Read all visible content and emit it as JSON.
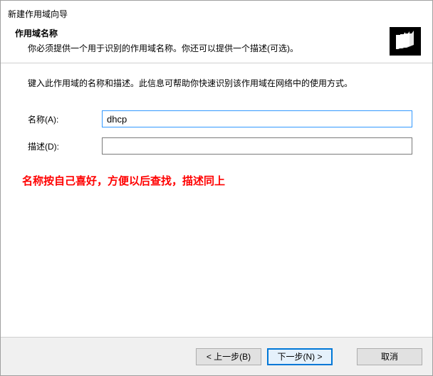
{
  "window": {
    "title": "新建作用域向导"
  },
  "header": {
    "title": "作用域名称",
    "subtitle": "你必须提供一个用于识别的作用域名称。你还可以提供一个描述(可选)。"
  },
  "content": {
    "intro": "键入此作用域的名称和描述。此信息可帮助你快速识别该作用域在网络中的使用方式。",
    "name_label": "名称(A):",
    "name_value": "dhcp",
    "desc_label": "描述(D):",
    "desc_value": "",
    "annotation": "名称按自己喜好，方便以后查找，描述同上"
  },
  "footer": {
    "back": "< 上一步(B)",
    "next": "下一步(N) >",
    "cancel": "取消"
  },
  "icons": {
    "header_icon": "files-icon"
  }
}
